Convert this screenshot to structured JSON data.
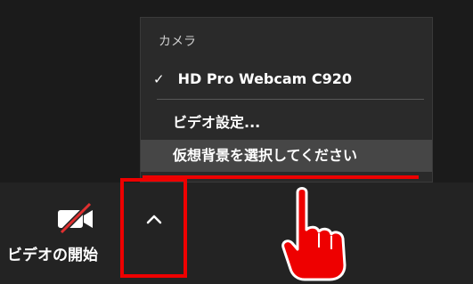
{
  "menu": {
    "header": "カメラ",
    "selected_camera": "HD Pro Webcam C920",
    "check_mark": "✓",
    "video_settings": "ビデオ設定...",
    "virtual_background": "仮想背景を選択してください"
  },
  "toolbar": {
    "video_label": "ビデオの開始",
    "video_icon": "video-off-icon",
    "chevron_icon": "chevron-up-icon"
  },
  "annotation": {
    "pointer_icon": "pointing-hand-icon",
    "highlight_color": "#ee0000"
  }
}
